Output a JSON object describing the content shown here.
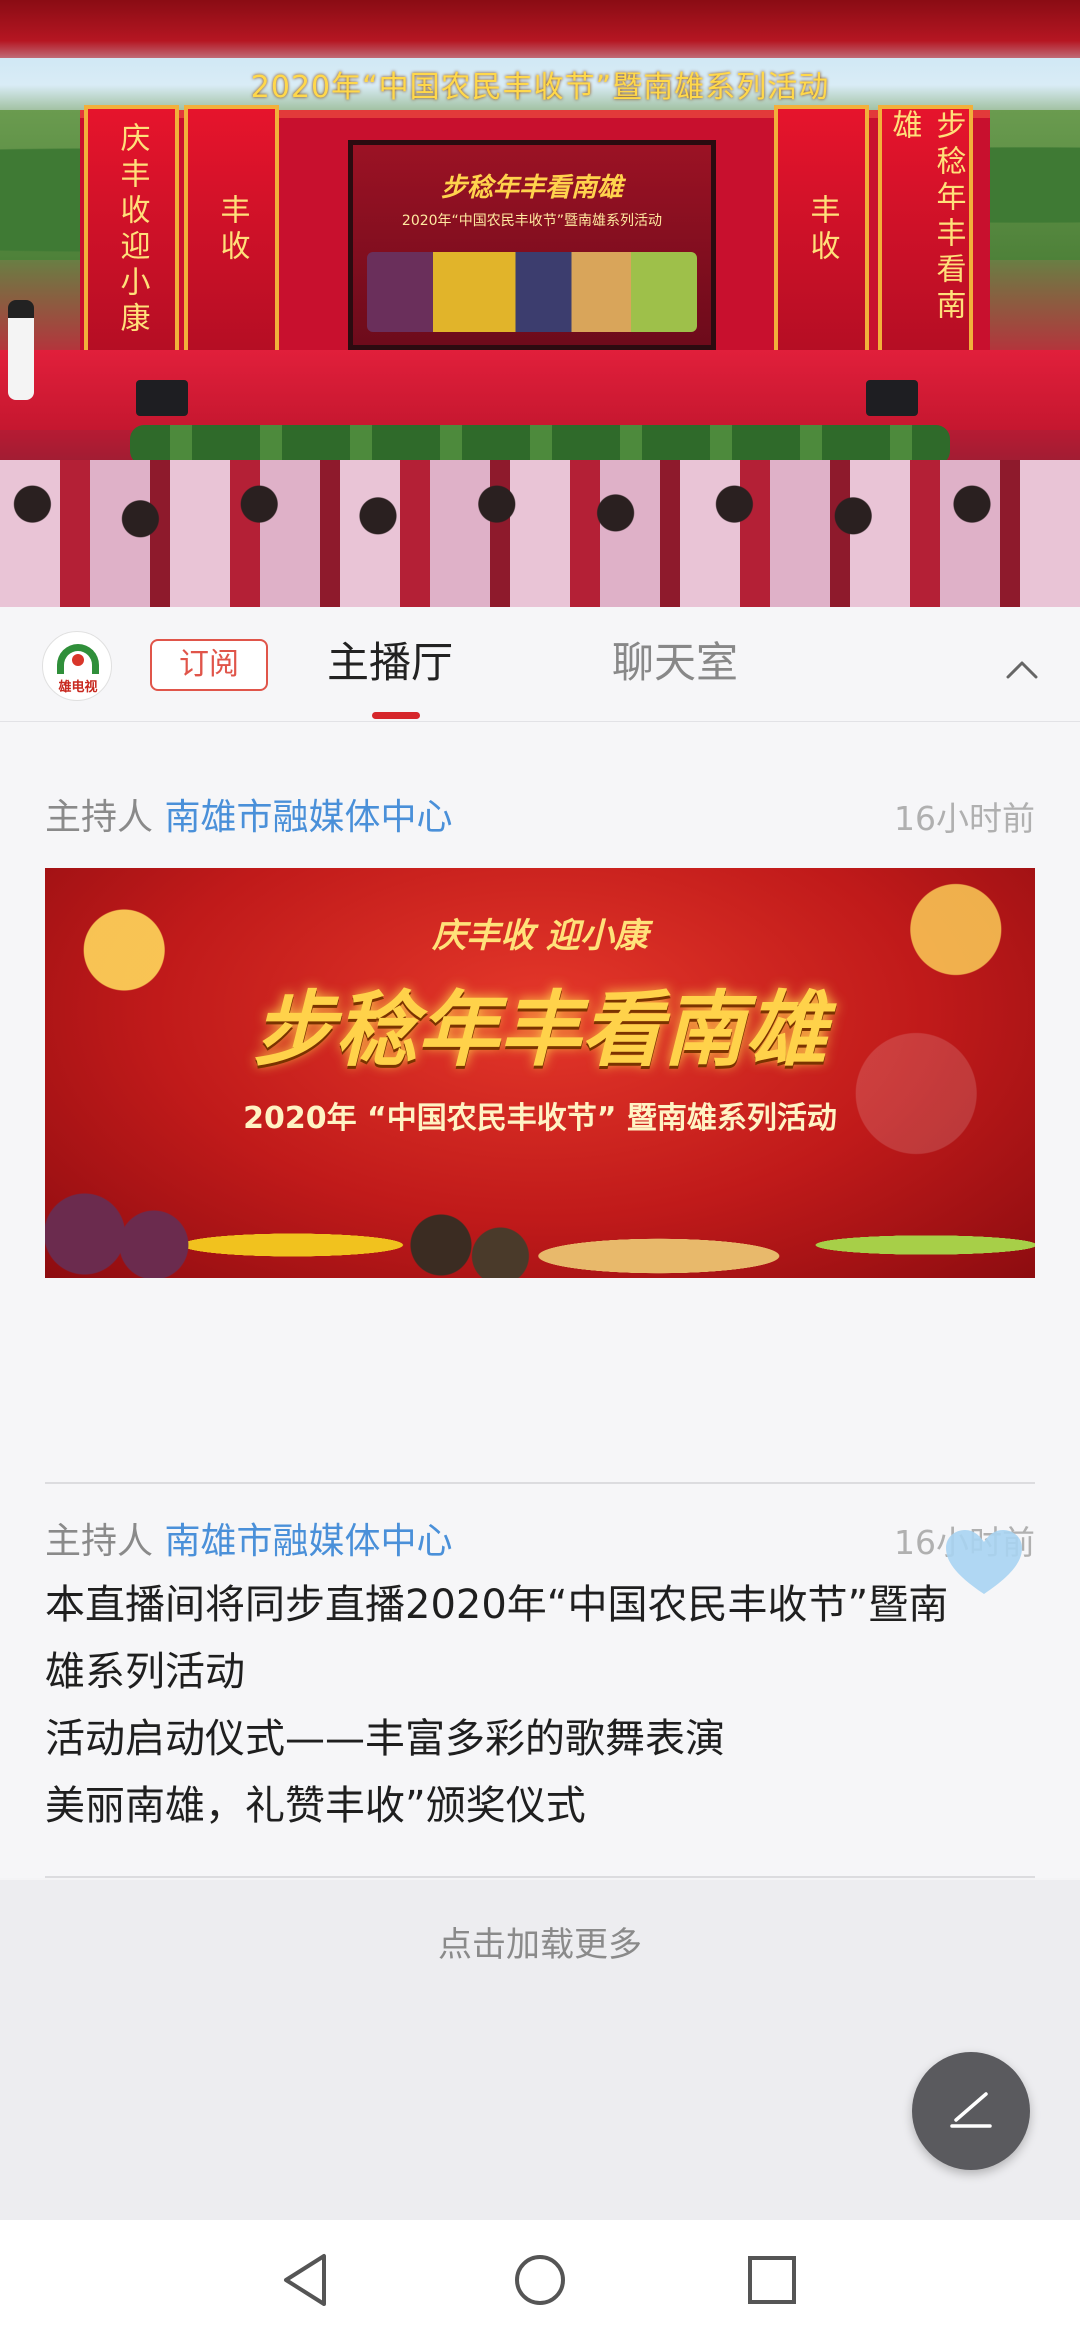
{
  "video": {
    "banner": "2020年“中国农民丰收节”暨南雄系列活动",
    "pillar_left_outer": "庆丰收迎小康",
    "pillar_left_inner": "丰收",
    "pillar_right_inner": "丰收",
    "pillar_right_outer": "步稔年丰看南雄",
    "screen_slogan": "步稔年丰看南雄",
    "screen_subtitle": "2020年“中国农民丰收节”暨南雄系列活动"
  },
  "tabbar": {
    "logo_text": "雄电视",
    "subscribe_label": "订阅",
    "tabs": [
      {
        "label": "主播厅",
        "active": true
      },
      {
        "label": "聊天室",
        "active": false
      }
    ]
  },
  "posts": [
    {
      "role": "主持人",
      "author": "南雄市融媒体中心",
      "time": "16小时前",
      "image": {
        "line1": "庆丰收 迎小康",
        "line2": "步稔年丰看南雄",
        "line3": "2020年 “中国农民丰收节” 暨南雄系列活动"
      }
    },
    {
      "role": "主持人",
      "author": "南雄市融媒体中心",
      "time": "16小时前",
      "text": [
        "本直播间将同步直播2020年“中国农民丰收节”暨南",
        "雄系列活动",
        "活动启动仪式——丰富多彩的歌舞表演",
        "美丽南雄，礼赞丰收”颁奖仪式"
      ]
    }
  ],
  "load_more_label": "点击加载更多",
  "icons": {
    "collapse": "chevron-up-icon",
    "fab": "edit-icon",
    "like": "heart-icon",
    "nav": [
      "back-icon",
      "home-icon",
      "recents-icon"
    ]
  },
  "colors": {
    "accent_red": "#d6262b",
    "author_blue": "#4a90d9",
    "subscribe_red": "#e0554a"
  }
}
